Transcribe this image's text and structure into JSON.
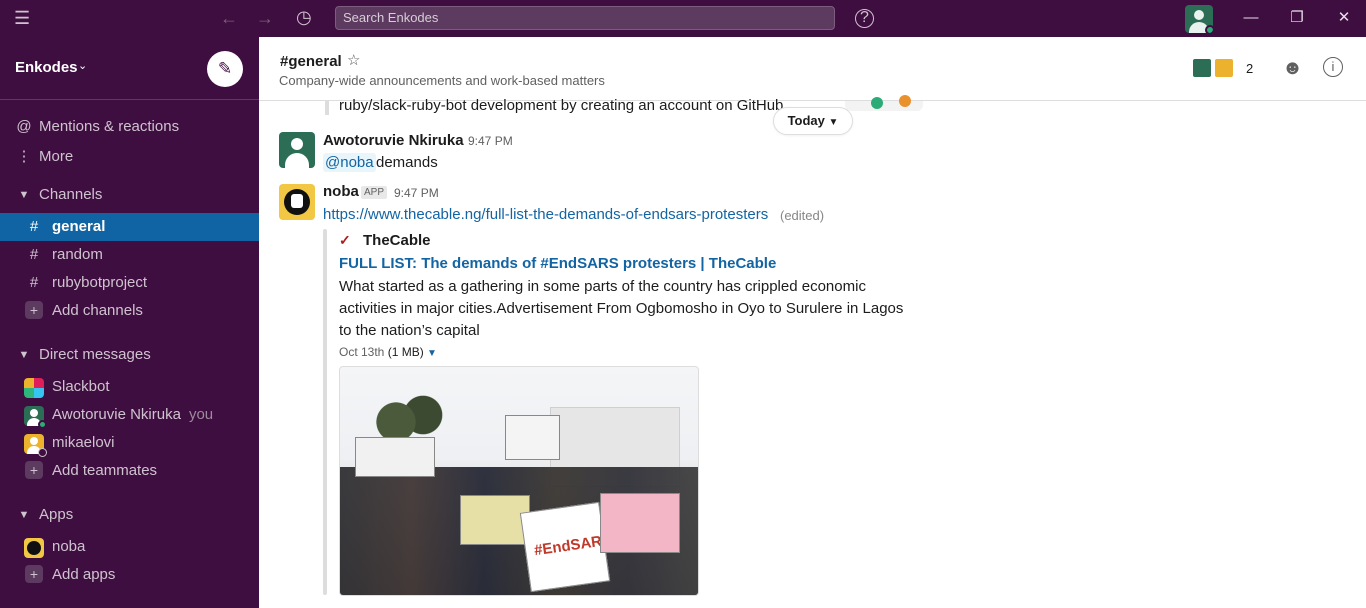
{
  "topbar": {
    "search_placeholder": "Search Enkodes"
  },
  "workspace": {
    "name": "Enkodes"
  },
  "sidebar": {
    "mentions": "Mentions & reactions",
    "more": "More",
    "channels_header": "Channels",
    "channels": [
      "general",
      "random",
      "rubybotproject"
    ],
    "add_channels": "Add channels",
    "dm_header": "Direct messages",
    "dms": [
      {
        "name": "Slackbot"
      },
      {
        "name": "Awotoruvie Nkiruka",
        "suffix": "you"
      },
      {
        "name": "mikaelovi"
      }
    ],
    "add_teammates": "Add teammates",
    "apps_header": "Apps",
    "apps": [
      "noba"
    ],
    "add_apps": "Add apps"
  },
  "channel": {
    "name": "#general",
    "topic": "Company-wide announcements and work-based matters",
    "member_count": "2"
  },
  "messages": {
    "prev_line": "ruby/slack-ruby-bot development by creating an account on GitHub.",
    "day_divider": "Today",
    "m1": {
      "sender": "Awotoruvie Nkiruka",
      "time": "9:47 PM",
      "mention": "@noba",
      "text": "demands"
    },
    "m2": {
      "sender": "noba",
      "badge": "APP",
      "time": "9:47 PM",
      "link": "https://www.thecable.ng/full-list-the-demands-of-endsars-protesters",
      "edited": "(edited)",
      "unfurl": {
        "site_name": "TheCable",
        "title": "FULL LIST: The demands of #EndSARS protesters | TheCable",
        "description": "What started as a gathering in some parts of the country has crippled economic activities in major cities.Advertisement From Ogbomosho in Oyo to Surulere in Lagos to the nation’s capital",
        "date": "Oct 13th",
        "size": "(1 MB)",
        "image_sign_text": "#EndSARS"
      }
    }
  },
  "colors": {
    "sidebar_bg": "#3f0e40",
    "active_channel": "#1164a3",
    "link": "#1264a3",
    "presence": "#2bac76"
  }
}
